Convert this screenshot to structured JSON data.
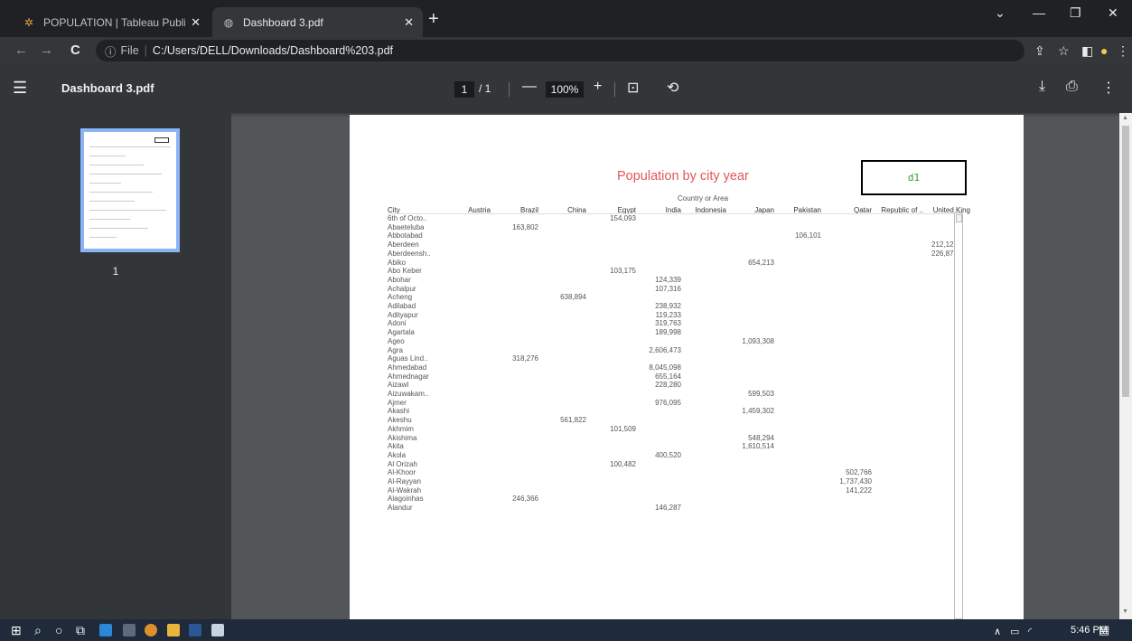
{
  "tabs": [
    {
      "title": "POPULATION | Tableau Public",
      "icon": "tableau-icon"
    },
    {
      "title": "Dashboard 3.pdf",
      "icon": "globe-icon"
    }
  ],
  "address": {
    "secure_label": "File",
    "url": "C:/Users/DELL/Downloads/Dashboard%203.pdf"
  },
  "pdf": {
    "file_name": "Dashboard 3.pdf",
    "page_current": "1",
    "page_total": "/ 1",
    "zoom": "100%",
    "thumb_label": "1"
  },
  "page_content": {
    "title": "Population by city year",
    "box_label": "d1",
    "column_group": "Country or Area",
    "columns": [
      "City",
      "Austria",
      "Brazil",
      "China",
      "Egypt",
      "India",
      "Indonesia",
      "Japan",
      "Pakistan",
      "Qatar",
      "Republic of ..",
      "United King"
    ],
    "rows": [
      {
        "city": "6th of Octo..",
        "col": 4,
        "value": "154,093"
      },
      {
        "city": "Abaeteluba",
        "col": 2,
        "value": "163,802"
      },
      {
        "city": "Abbotabad",
        "col": 8,
        "value": "106,101"
      },
      {
        "city": "Aberdeen",
        "col": 11,
        "value": "212,12"
      },
      {
        "city": "Aberdeensh..",
        "col": 11,
        "value": "226,87"
      },
      {
        "city": "Abiko",
        "col": 7,
        "value": "654,213"
      },
      {
        "city": "Abo Keber",
        "col": 4,
        "value": "103,175"
      },
      {
        "city": "Abohar",
        "col": 5,
        "value": "124,339"
      },
      {
        "city": "Achalpur",
        "col": 5,
        "value": "107,316"
      },
      {
        "city": "Acheng",
        "col": 3,
        "value": "638,894"
      },
      {
        "city": "Adilabad",
        "col": 5,
        "value": "238,932"
      },
      {
        "city": "Adityapur",
        "col": 5,
        "value": "119,233"
      },
      {
        "city": "Adoni",
        "col": 5,
        "value": "319,763"
      },
      {
        "city": "Agartala",
        "col": 5,
        "value": "189,998"
      },
      {
        "city": "Ageo",
        "col": 7,
        "value": "1,093,308"
      },
      {
        "city": "Agra",
        "col": 5,
        "value": "2,606,473"
      },
      {
        "city": "Aguas Lind..",
        "col": 2,
        "value": "318,276"
      },
      {
        "city": "Ahmedabad",
        "col": 5,
        "value": "8,045,098"
      },
      {
        "city": "Ahmednagar",
        "col": 5,
        "value": "655,164"
      },
      {
        "city": "Aizawl",
        "col": 5,
        "value": "228,280"
      },
      {
        "city": "Aizuwakam..",
        "col": 7,
        "value": "599,503"
      },
      {
        "city": "Ajmer",
        "col": 5,
        "value": "976,095"
      },
      {
        "city": "Akashi",
        "col": 7,
        "value": "1,459,302"
      },
      {
        "city": "Akeshu",
        "col": 3,
        "value": "561,822"
      },
      {
        "city": "Akhmim",
        "col": 4,
        "value": "101,509"
      },
      {
        "city": "Akishima",
        "col": 7,
        "value": "548,294"
      },
      {
        "city": "Akita",
        "col": 7,
        "value": "1,610,514"
      },
      {
        "city": "Akola",
        "col": 5,
        "value": "400,520"
      },
      {
        "city": "Al Orizah",
        "col": 4,
        "value": "100,482"
      },
      {
        "city": "Al-Khoor",
        "col": 9,
        "value": "502,766"
      },
      {
        "city": "Al-Rayyan",
        "col": 9,
        "value": "1,737,430"
      },
      {
        "city": "Al-Wakrah",
        "col": 9,
        "value": "141,222"
      },
      {
        "city": "Alagoinhas",
        "col": 2,
        "value": "246,366"
      },
      {
        "city": "Alandur",
        "col": 5,
        "value": "146,287"
      }
    ]
  },
  "taskbar": {
    "time": "5:46 PM"
  }
}
